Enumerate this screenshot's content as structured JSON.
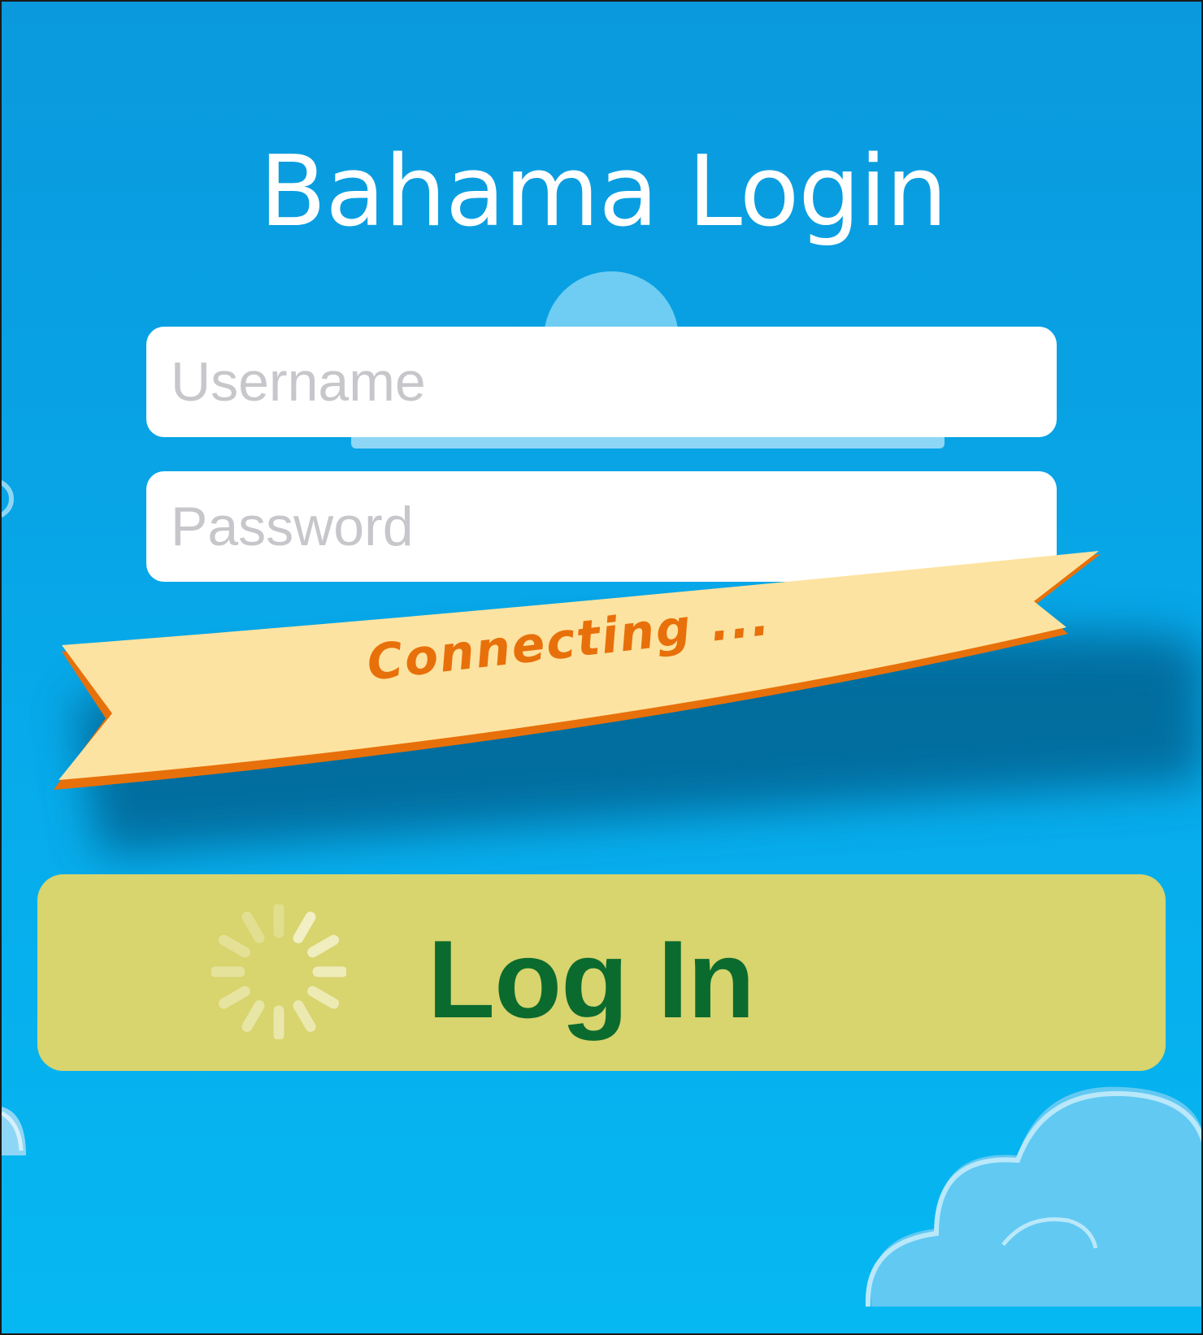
{
  "title": "Bahama Login",
  "form": {
    "username_placeholder": "Username",
    "username_value": "",
    "password_placeholder": "Password",
    "password_value": ""
  },
  "status": {
    "text": "Connecting ..."
  },
  "login_button": {
    "label": "Log In",
    "loading": true
  },
  "colors": {
    "sky_top": "#0a99dd",
    "sky_bottom": "#06b8f2",
    "ribbon_fill": "#fde3a1",
    "ribbon_edge": "#e8700a",
    "button_fill": "#d8d46e",
    "button_text": "#0b6b2e"
  },
  "icons": {
    "spinner": "loading-spinner-icon",
    "decor": "cloud-icon"
  }
}
